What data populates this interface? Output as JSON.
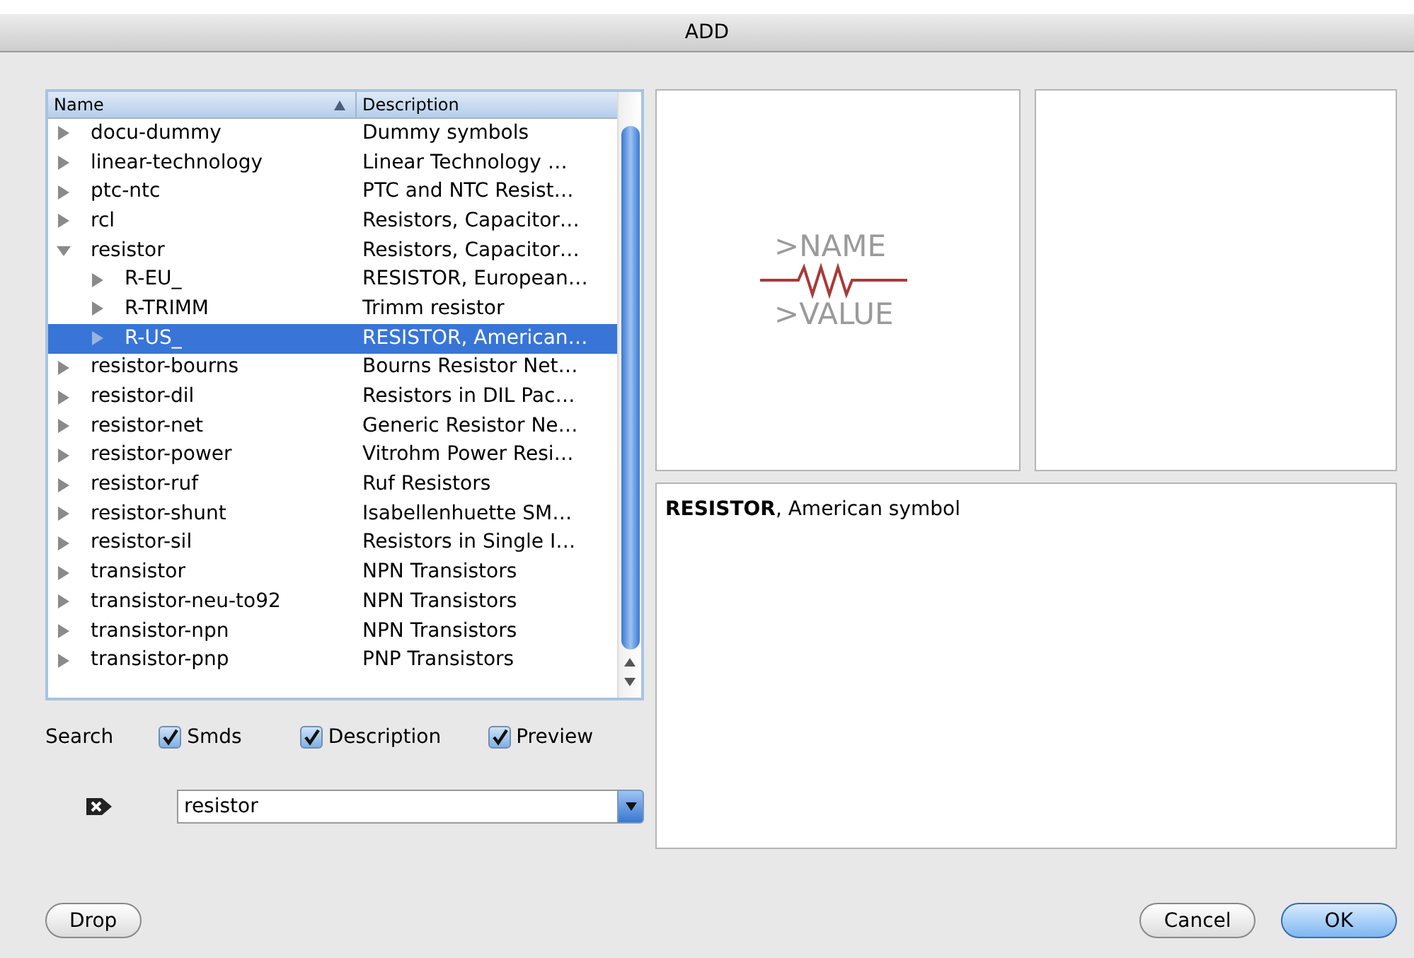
{
  "window": {
    "title": "ADD"
  },
  "tree": {
    "columns": [
      {
        "label": "Name",
        "sorted_ascending": true
      },
      {
        "label": "Description"
      }
    ],
    "items": [
      {
        "name": "docu-dummy",
        "description": "Dummy symbols",
        "expanded": false,
        "selected": false
      },
      {
        "name": "linear-technology",
        "description": "Linear Technology …",
        "expanded": false,
        "selected": false
      },
      {
        "name": "ptc-ntc",
        "description": "PTC and NTC Resist…",
        "expanded": false,
        "selected": false
      },
      {
        "name": "rcl",
        "description": "Resistors, Capacitor…",
        "expanded": false,
        "selected": false
      },
      {
        "name": "resistor",
        "description": "Resistors, Capacitor…",
        "expanded": true,
        "selected": false,
        "children": [
          {
            "name": "R-EU_",
            "description": "RESISTOR, European…",
            "expanded": false,
            "selected": false
          },
          {
            "name": "R-TRIMM",
            "description": "Trimm resistor",
            "expanded": false,
            "selected": false
          },
          {
            "name": "R-US_",
            "description": "RESISTOR, American…",
            "expanded": false,
            "selected": true
          }
        ]
      },
      {
        "name": "resistor-bourns",
        "description": "Bourns Resistor Net…",
        "expanded": false,
        "selected": false
      },
      {
        "name": "resistor-dil",
        "description": "Resistors in DIL Pac…",
        "expanded": false,
        "selected": false
      },
      {
        "name": "resistor-net",
        "description": "Generic Resistor Ne…",
        "expanded": false,
        "selected": false
      },
      {
        "name": "resistor-power",
        "description": "Vitrohm Power Resi…",
        "expanded": false,
        "selected": false
      },
      {
        "name": "resistor-ruf",
        "description": "Ruf Resistors",
        "expanded": false,
        "selected": false
      },
      {
        "name": "resistor-shunt",
        "description": "Isabellenhuette SM…",
        "expanded": false,
        "selected": false
      },
      {
        "name": "resistor-sil",
        "description": "Resistors in Single I…",
        "expanded": false,
        "selected": false
      },
      {
        "name": "transistor",
        "description": "NPN Transistors",
        "expanded": false,
        "selected": false
      },
      {
        "name": "transistor-neu-to92",
        "description": "NPN Transistors",
        "expanded": false,
        "selected": false
      },
      {
        "name": "transistor-npn",
        "description": "NPN Transistors",
        "expanded": false,
        "selected": false
      },
      {
        "name": "transistor-pnp",
        "description": "PNP Transistors",
        "expanded": false,
        "selected": false
      }
    ]
  },
  "search": {
    "label": "Search",
    "options": [
      {
        "label": "Smds",
        "checked": true
      },
      {
        "label": "Description",
        "checked": true
      },
      {
        "label": "Preview",
        "checked": true
      }
    ],
    "value": "resistor"
  },
  "preview": {
    "name_label": ">NAME",
    "value_label": ">VALUE"
  },
  "description": "**RESISTOR**, American symbol",
  "buttons": [
    {
      "label": "Drop",
      "default": false
    },
    {
      "label": "Cancel",
      "default": false
    },
    {
      "label": "OK",
      "default": true
    }
  ]
}
